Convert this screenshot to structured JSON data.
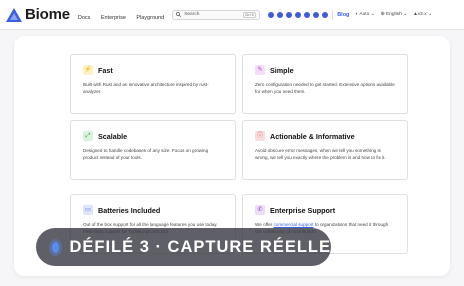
{
  "header": {
    "brand": "Biome",
    "nav": [
      "Docs",
      "Enterprise",
      "Playground"
    ],
    "search": {
      "placeholder": "Search",
      "shortcut": "Ctrl K"
    },
    "blog": "Blog",
    "theme": "Auto",
    "language": "English",
    "version": "v2.x"
  },
  "features": [
    {
      "title": "Fast",
      "desc": "Built with Rust and an innovative architecture inspired by rust-analyzer.",
      "icon": "lightning-icon",
      "accent": "#f2b705"
    },
    {
      "title": "Simple",
      "desc": "Zero configuration needed to get started. Extensive options available for when you need them.",
      "icon": "pencil-icon",
      "accent": "#c04de0"
    },
    {
      "title": "Scalable",
      "desc": "Designed to handle codebases of any size. Focus on growing product instead of your tools.",
      "icon": "expand-icon",
      "accent": "#3fae4b"
    },
    {
      "title": "Actionable & Informative",
      "desc": "Avoid obscure error messages, when we tell you something is wrong, we tell you exactly where the problem is and how to fix it.",
      "icon": "info-icon",
      "accent": "#e0414f"
    },
    {
      "title": "Batteries Included",
      "desc": "Out of the box support for all the language features you use today. First class support for TypeScript and JSX.",
      "icon": "battery-icon",
      "accent": "#3a5ee6"
    },
    {
      "title": "Enterprise Support",
      "desc_pre": "We offer ",
      "desc_link": "commercial support",
      "desc_post": " to organizations that need it through our community of contributors.",
      "icon": "phone-icon",
      "accent": "#9d3fd8"
    }
  ],
  "overlay": {
    "label": "DÉFILÉ 3 · CAPTURE RÉELLE"
  }
}
